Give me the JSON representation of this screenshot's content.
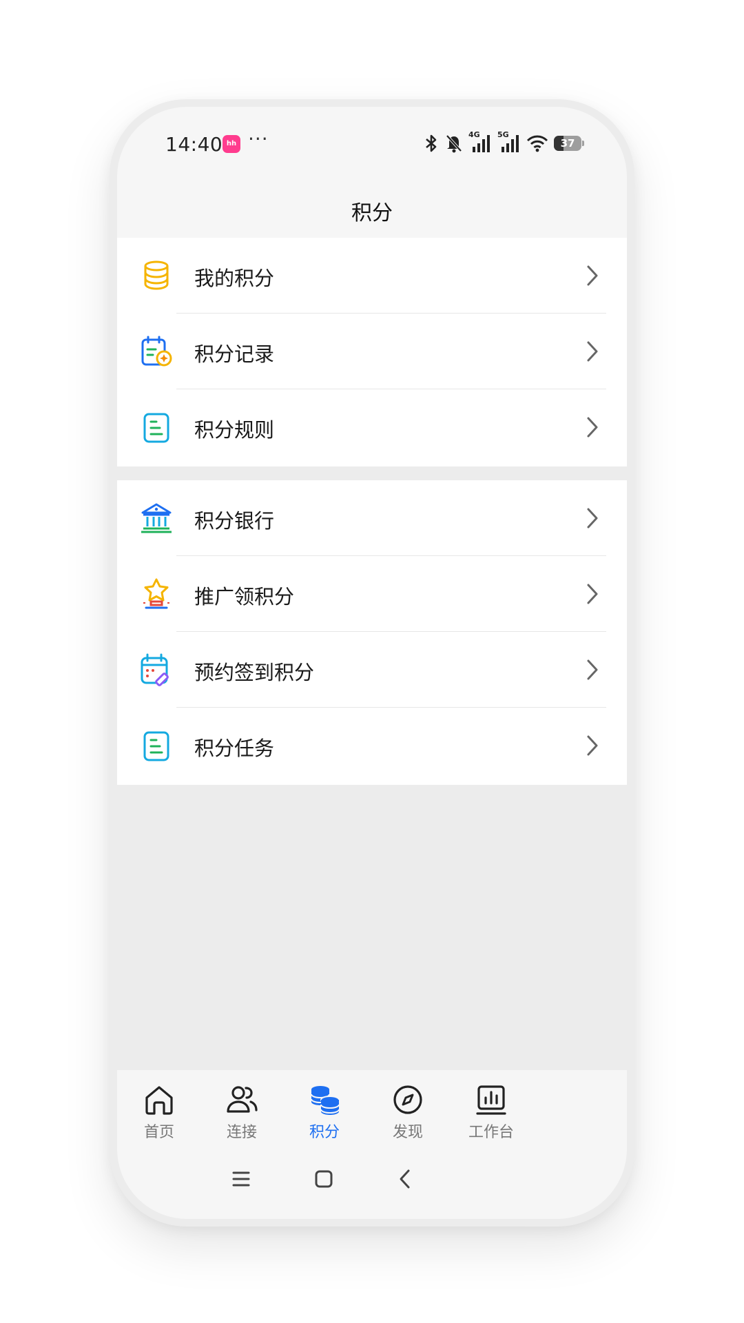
{
  "status_bar": {
    "time": "14:40",
    "app_badge": "hh",
    "more_indicator": "···",
    "network_1": "4G",
    "network_2": "5G",
    "battery": "37",
    "icons": [
      "bluetooth-icon",
      "mute-bell-icon",
      "signal-4g-icon",
      "signal-5g-icon",
      "wifi-icon",
      "battery-icon"
    ]
  },
  "header": {
    "title": "积分"
  },
  "menu_groups": [
    {
      "items": [
        {
          "label": "我的积分",
          "icon": "coin-stack-icon"
        },
        {
          "label": "积分记录",
          "icon": "record-calendar-icon"
        },
        {
          "label": "积分规则",
          "icon": "rules-document-icon"
        }
      ]
    },
    {
      "items": [
        {
          "label": "积分银行",
          "icon": "bank-icon"
        },
        {
          "label": "推广领积分",
          "icon": "star-trophy-icon"
        },
        {
          "label": "预约签到积分",
          "icon": "calendar-edit-icon"
        },
        {
          "label": "积分任务",
          "icon": "task-document-icon"
        }
      ]
    }
  ],
  "tab_bar": {
    "active": "积分",
    "tabs": [
      {
        "label": "首页",
        "icon": "home-icon"
      },
      {
        "label": "连接",
        "icon": "contacts-icon"
      },
      {
        "label": "积分",
        "icon": "coins-icon"
      },
      {
        "label": "发现",
        "icon": "compass-icon"
      },
      {
        "label": "工作台",
        "icon": "dashboard-icon"
      }
    ]
  },
  "system_nav": [
    "menu-icon",
    "home-square-icon",
    "back-icon"
  ],
  "colors": {
    "accent_blue": "#1e6ff1",
    "coin_yellow": "#f5b400",
    "green": "#1fb25a",
    "cyan": "#14a9e0",
    "page_background": "#ececec"
  }
}
